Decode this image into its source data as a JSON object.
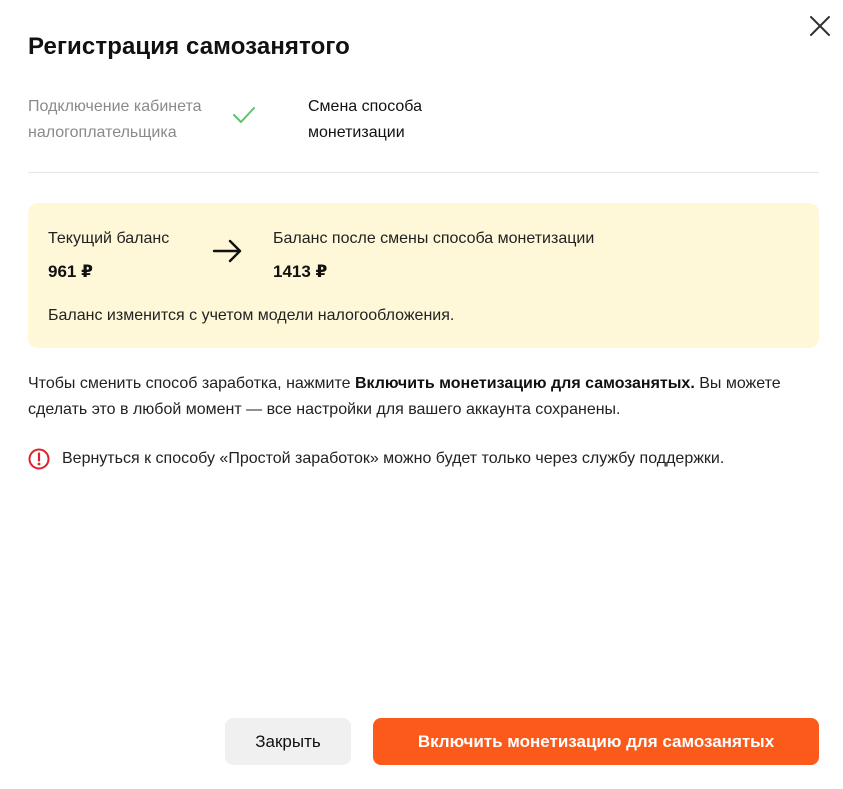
{
  "dialog": {
    "title": "Регистрация самозанятого",
    "close_icon": "close-icon"
  },
  "steps": [
    {
      "label_line1": "Подключение кабинета",
      "label_line2": "налогоплательщика",
      "status": "done",
      "icon": "checkmark-icon"
    },
    {
      "label_line1": "Смена способа",
      "label_line2": "монетизации",
      "status": "current"
    }
  ],
  "balance": {
    "current_label": "Текущий баланс",
    "current_value": "961 ₽",
    "arrow_icon": "arrow-right-icon",
    "after_label": "Баланс после смены способа монетизации",
    "after_value": "1413 ₽",
    "note": "Баланс изменится с учетом модели налогообложения.",
    "background_color": "#fef7d8"
  },
  "info": {
    "text_before": "Чтобы сменить способ заработка, нажмите ",
    "text_bold": "Включить монетизацию для самозанятых.",
    "text_after": " Вы можете сделать это в любой момент — все настройки для вашего аккаунта сохранены."
  },
  "warning": {
    "icon": "alert-circle-icon",
    "text": "Вернуться к способу «Простой заработок» можно будет только через службу поддержки.",
    "color": "#e0202a"
  },
  "buttons": {
    "close_label": "Закрыть",
    "enable_label": "Включить монетизацию для самозанятых",
    "accent_color": "#fc5a1a"
  }
}
